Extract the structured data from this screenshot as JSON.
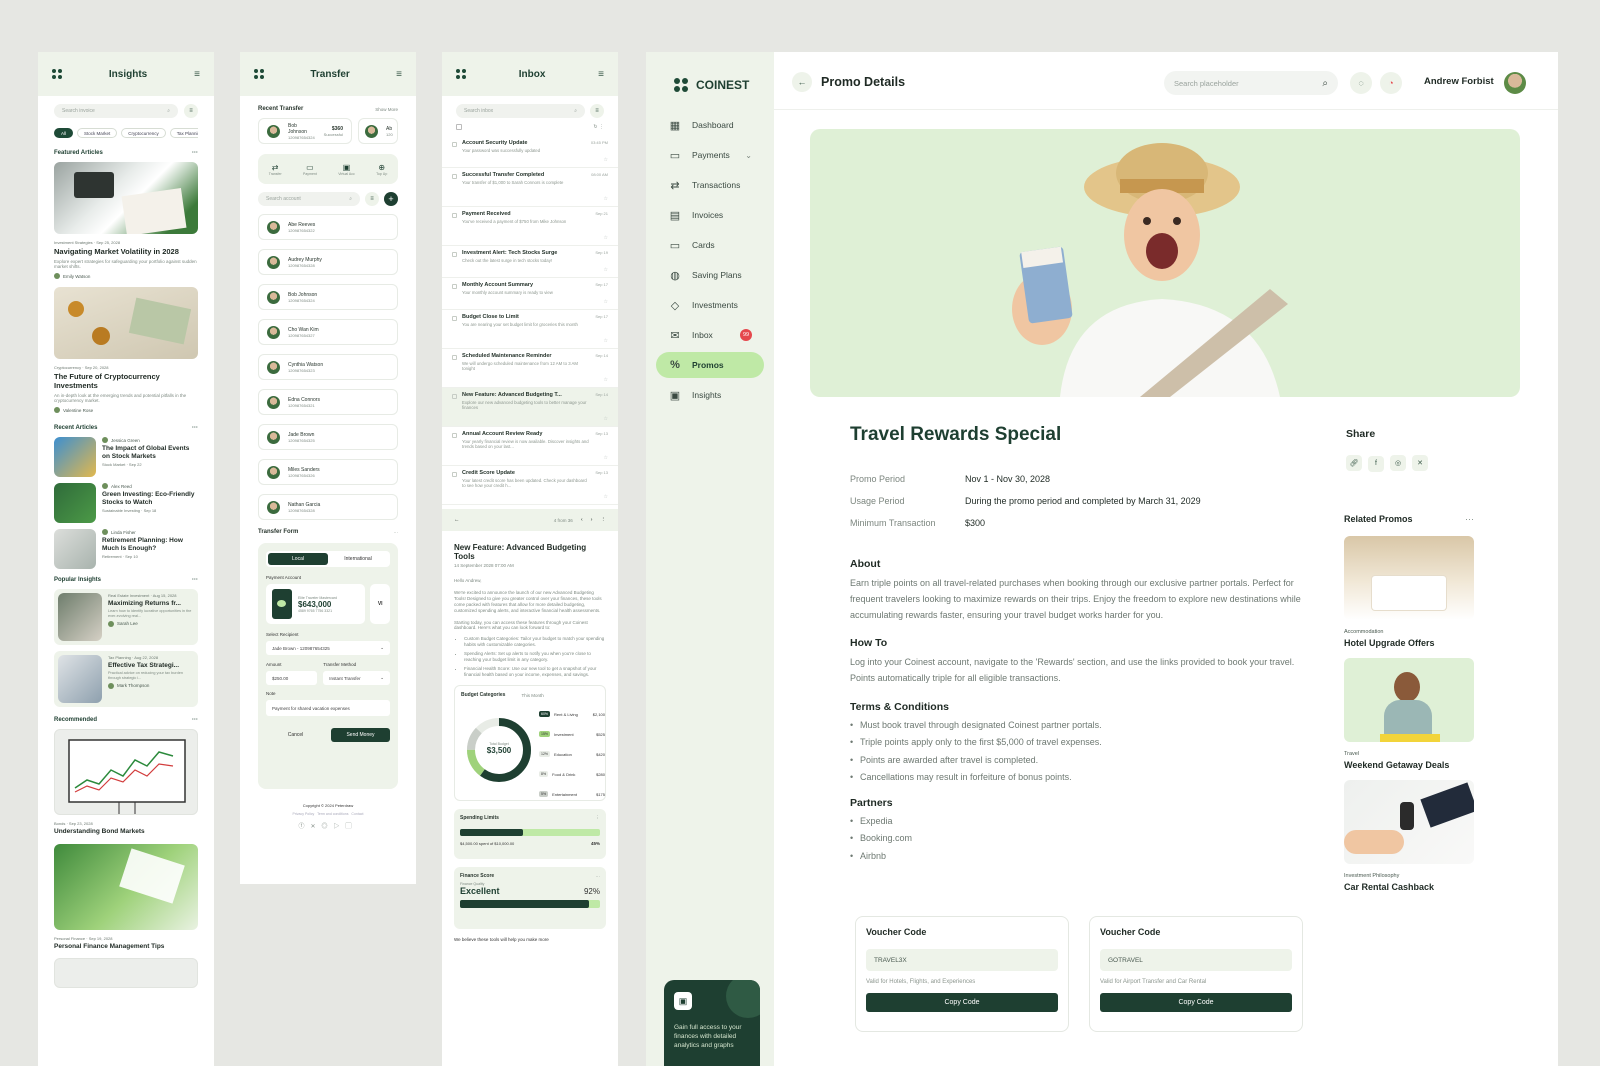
{
  "insights": {
    "title": "Insights",
    "search_placeholder": "Search invoice",
    "chips": [
      "All",
      "Stock Market",
      "Cryptocurrency",
      "Tax Planning"
    ],
    "featured_heading": "Featured Articles",
    "featured": [
      {
        "category": "Investment Strategies",
        "date": "Sep 25, 2028",
        "title": "Navigating Market Volatility in 2028",
        "desc": "Explore expert strategies for safeguarding your portfolio against sudden market shifts.",
        "author": "Emily Watson"
      },
      {
        "category": "Cryptocurrency",
        "date": "Sep 20, 2028",
        "title": "The Future of Cryptocurrency Investments",
        "desc": "An in-depth look at the emerging trends and potential pitfalls in the cryptocurrency market.",
        "author": "Valentine Rose"
      }
    ],
    "recent_heading": "Recent Articles",
    "recent": [
      {
        "author": "Jessica Green",
        "title": "The Impact of Global Events on Stock Markets",
        "category": "Stock Market",
        "date": "Sep 22"
      },
      {
        "author": "Alex Reed",
        "title": "Green Investing: Eco-Friendly Stocks to Watch",
        "category": "Sustainable Investing",
        "date": "Sep 18"
      },
      {
        "author": "Linda Fisher",
        "title": "Retirement Planning: How Much Is Enough?",
        "category": "Retirement",
        "date": "Sep 10"
      }
    ],
    "popular_heading": "Popular Insights",
    "popular": [
      {
        "category": "Real Estate Investment",
        "date": "Aug 15, 2028",
        "title": "Maximizing Returns fr...",
        "desc": "Learn how to identify lucrative opportunities in the ever-evolving real...",
        "author": "Sarah Lee"
      },
      {
        "category": "Tax Planning",
        "date": "Aug 22, 2028",
        "title": "Effective Tax Strategi...",
        "desc": "Practical advice on reducing your tax burden through strategic i...",
        "author": "Mark Thompson"
      }
    ],
    "recommended_heading": "Recommended",
    "recommended": [
      {
        "category": "Bonds",
        "date": "Sep 23, 2028",
        "title": "Understanding Bond Markets"
      },
      {
        "category": "Personal Finance",
        "date": "Sep 19, 2028",
        "title": "Personal Finance Management Tips"
      }
    ]
  },
  "transfer": {
    "title": "Transfer",
    "recent_heading": "Recent Transfer",
    "show_more": "Show More",
    "recent_card": {
      "name": "Bob Johnson",
      "account": "120987654324",
      "amount": "$360",
      "status": "Successful"
    },
    "recent_card2": {
      "name": "Ab",
      "account": "120"
    },
    "actions": [
      "Transfer",
      "Payment",
      "Virtual Acc",
      "Top Up"
    ],
    "search_placeholder": "Search account",
    "recipients": [
      {
        "name": "Abe Reeves",
        "account": "120987654322"
      },
      {
        "name": "Audrey Murphy",
        "account": "120987654328"
      },
      {
        "name": "Bob Johnson",
        "account": "120987654324"
      },
      {
        "name": "Cho Wan Kim",
        "account": "120987654327"
      },
      {
        "name": "Cynthia Watson",
        "account": "120987654323"
      },
      {
        "name": "Edna Connors",
        "account": "120987654321"
      },
      {
        "name": "Jade Brown",
        "account": "120987654325"
      },
      {
        "name": "Miles Sanders",
        "account": "120987654326"
      },
      {
        "name": "Nathan Garcia",
        "account": "120987654328"
      }
    ],
    "form_heading": "Transfer Form",
    "tabs": [
      "Local",
      "International"
    ],
    "payment_account_label": "Payment Account",
    "card_name": "Elite Traveler Mastercard",
    "card_balance": "$643,000",
    "card_number": "4589 9765 7756 3321",
    "card_brand": "VI",
    "recipient_label": "Select Recipient",
    "recipient_value": "Jade Brown - 120987654325",
    "amount_label": "Amount",
    "amount_value": "$250.00",
    "method_label": "Transfer Method",
    "method_value": "Instant Transfer",
    "note_label": "Note",
    "note_value": "Payment for shared vacation expenses",
    "cancel": "Cancel",
    "send": "Send Money",
    "copyright": "Copyright © 2024 Peterdraw",
    "footer_links": [
      "Privacy Policy",
      "Term and conditions",
      "Contact"
    ]
  },
  "inbox": {
    "title": "Inbox",
    "search_placeholder": "Search inbox",
    "items": [
      {
        "title": "Account Security Update",
        "time": "03:45 PM",
        "desc": "Your password was successfully updated"
      },
      {
        "title": "Successful Transfer Completed",
        "time": "08:00 AM",
        "desc": "Your transfer of $1,000 to Sarah Connors is complete"
      },
      {
        "title": "Payment Received",
        "time": "Sep 21",
        "desc": "You've received a payment of $750 from Mike Johnson"
      },
      {
        "title": "Investment Alert: Tech Stocks Surge",
        "time": "Sep 19",
        "desc": "Check out the latest surge in tech stocks today!"
      },
      {
        "title": "Monthly Account Summary",
        "time": "Sep 17",
        "desc": "Your monthly account summary is ready to view"
      },
      {
        "title": "Budget Close to Limit",
        "time": "Sep 17",
        "desc": "You are nearing your set budget limit for groceries this month"
      },
      {
        "title": "Scheduled Maintenance Reminder",
        "time": "Sep 14",
        "desc": "We will undergo scheduled maintenance from 12 AM to 3 AM tonight"
      },
      {
        "title": "New Feature: Advanced Budgeting T...",
        "time": "Sep 14",
        "desc": "Explore our new advanced budgeting tools to better manage your finances"
      },
      {
        "title": "Annual Account Review Ready",
        "time": "Sep 13",
        "desc": "Your yearly financial review is now available. Discover insights and trends based on your last..."
      },
      {
        "title": "Credit Score Update",
        "time": "Sep 13",
        "desc": "Your latest credit score has been updated. Check your dashboard to see how your credit h..."
      }
    ],
    "pager": "4 from 36",
    "detail_title": "New Feature: Advanced Budgeting Tools",
    "detail_date": "14 September 2028 07:00 AM",
    "detail_greeting": "Hello Andrew,",
    "detail_p1": "We're excited to announce the launch of our new Advanced Budgeting Tools! Designed to give you greater control over your finances, these tools come packed with features that allow for more detailed budgeting, customized spending alerts, and interactive financial health assessments.",
    "detail_p2": "Starting today, you can access these features through your Coinest dashboard. Here's what you can look forward to:",
    "detail_bullets": [
      "Custom Budget Categories: Tailor your budget to match your spending habits with customizable categories.",
      "Spending Alerts: Set up alerts to notify you when you're close to reaching your budget limit in any category.",
      "Financial Health Score: Use our new tool to get a snapshot of your financial health based on your income, expenses, and savings."
    ],
    "budget_heading": "Budget Categories",
    "budget_period": "This Month",
    "budget_total_label": "Total Budget",
    "budget_total": "$3,500",
    "budget_rows": [
      {
        "pct": "60%",
        "label": "Rent & Living",
        "amount": "$2,100"
      },
      {
        "pct": "15%",
        "label": "Investment",
        "amount": "$525"
      },
      {
        "pct": "12%",
        "label": "Education",
        "amount": "$420"
      },
      {
        "pct": "8%",
        "label": "Food & Drink",
        "amount": "$280"
      },
      {
        "pct": "5%",
        "label": "Entertainment",
        "amount": "$175"
      }
    ],
    "spending_heading": "Spending Limits",
    "spending_text": "$4,500.00",
    "spending_sub": "spent of $10,000.00",
    "spending_pct": "45%",
    "spending_fraction": 0.45,
    "finance_heading": "Finance Score",
    "finance_sub": "Finance Quality",
    "finance_value": "Excellent",
    "finance_pct": "92%",
    "finance_fraction": 0.92,
    "footer_text": "We believe these tools will help you make more"
  },
  "app": {
    "brand": "COINEST",
    "nav": [
      {
        "label": "Dashboard",
        "icon": "grid-icon"
      },
      {
        "label": "Payments",
        "icon": "wallet-icon",
        "chevron": true
      },
      {
        "label": "Transactions",
        "icon": "arrows-icon"
      },
      {
        "label": "Invoices",
        "icon": "invoice-icon"
      },
      {
        "label": "Cards",
        "icon": "card-icon"
      },
      {
        "label": "Saving Plans",
        "icon": "piggy-icon"
      },
      {
        "label": "Investments",
        "icon": "diamond-icon"
      },
      {
        "label": "Inbox",
        "icon": "mail-icon",
        "badge": "99"
      },
      {
        "label": "Promos",
        "icon": "percent-icon",
        "active": true
      },
      {
        "label": "Insights",
        "icon": "insight-icon"
      }
    ],
    "upgrade_text": "Gain full access to your finances with detailed analytics and graphs",
    "header": {
      "title": "Promo Details",
      "search_placeholder": "Search placeholder",
      "user_name": "Andrew Forbist"
    },
    "promo": {
      "title": "Travel Rewards Special",
      "fields": [
        {
          "label": "Promo Period",
          "value": "Nov 1 - Nov 30, 2028"
        },
        {
          "label": "Usage Period",
          "value": "During the promo period and completed by March 31, 2029"
        },
        {
          "label": "Minimum Transaction",
          "value": "$300"
        }
      ],
      "about_heading": "About",
      "about_text": "Earn triple points on all travel-related purchases when booking through our exclusive partner portals. Perfect for frequent travelers looking to maximize rewards on their trips. Enjoy the freedom to explore new destinations while accumulating rewards faster, ensuring your travel budget works harder for you.",
      "howto_heading": "How To",
      "howto_text": "Log into your Coinest account, navigate to the 'Rewards' section, and use the links provided to book your travel. Points automatically triple for all eligible transactions.",
      "terms_heading": "Terms & Conditions",
      "terms": [
        "Must book travel through designated Coinest partner portals.",
        "Triple points apply only to the first $5,000 of travel expenses.",
        "Points are awarded after travel is completed.",
        "Cancellations may result in forfeiture of bonus points."
      ],
      "partners_heading": "Partners",
      "partners": [
        "Expedia",
        "Booking.com",
        "Airbnb"
      ],
      "vouchers": [
        {
          "title": "Voucher Code",
          "code": "TRAVEL3X",
          "note": "Valid for Hotels, Flights, and Experiences",
          "button": "Copy Code"
        },
        {
          "title": "Voucher Code",
          "code": "GOTRAVEL",
          "note": "Valid for Airport Transfer and Car Rental",
          "button": "Copy Code"
        }
      ]
    },
    "share_heading": "Share",
    "related_heading": "Related Promos",
    "related": [
      {
        "category": "Accommodation",
        "title": "Hotel Upgrade Offers"
      },
      {
        "category": "Travel",
        "title": "Weekend Getaway Deals"
      },
      {
        "category": "Investment Philosophy",
        "title": "Car Rental Cashback"
      }
    ]
  },
  "colors": {
    "primary": "#1e3f31",
    "accent": "#bfe9a6",
    "soft": "#eef3ea",
    "badge": "#e5484d"
  }
}
